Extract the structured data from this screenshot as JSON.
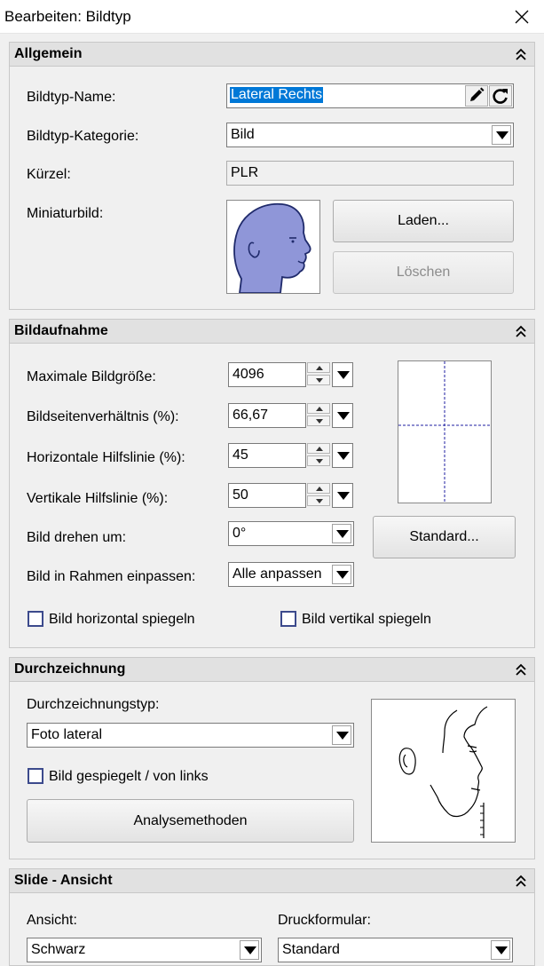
{
  "window": {
    "title": "Bearbeiten: Bildtyp"
  },
  "allgemein": {
    "header": "Allgemein",
    "name_label": "Bildtyp-Name:",
    "name_value": "Lateral Rechts",
    "kategorie_label": "Bildtyp-Kategorie:",
    "kategorie_value": "Bild",
    "kuerzel_label": "Kürzel:",
    "kuerzel_value": "PLR",
    "miniatur_label": "Miniaturbild:",
    "laden_button": "Laden...",
    "loeschen_button": "Löschen"
  },
  "bildaufnahme": {
    "header": "Bildaufnahme",
    "max_label": "Maximale Bildgröße:",
    "max_value": "4096",
    "ratio_label": "Bildseitenverhältnis (%):",
    "ratio_value": "66,67",
    "hline_label": "Horizontale Hilfslinie (%):",
    "hline_value": "45",
    "vline_label": "Vertikale Hilfslinie (%):",
    "vline_value": "50",
    "rotate_label": "Bild drehen um:",
    "rotate_value": "0°",
    "fit_label": "Bild in Rahmen einpassen:",
    "fit_value": "Alle anpassen",
    "standard_button": "Standard...",
    "mirror_h_label": "Bild horizontal spiegeln",
    "mirror_v_label": "Bild vertikal spiegeln",
    "guide_color": "#1e1ea0"
  },
  "durchzeichnung": {
    "header": "Durchzeichnung",
    "type_label": "Durchzeichnungstyp:",
    "type_value": "Foto lateral",
    "mirrored_label": "Bild gespiegelt / von links",
    "analysis_button": "Analysemethoden"
  },
  "slide": {
    "header": "Slide - Ansicht",
    "ansicht_label": "Ansicht:",
    "ansicht_value": "Schwarz",
    "druck_label": "Druckformular:",
    "druck_value": "Standard"
  },
  "colors": {
    "selection": "#0078d7",
    "head_fill": "#8f96d8",
    "head_stroke": "#1f2a6b"
  },
  "icons": [
    "close-icon",
    "collapse-icon",
    "pencil-icon",
    "refresh-icon",
    "chevron-down-icon",
    "spin-up-icon",
    "spin-down-icon"
  ]
}
